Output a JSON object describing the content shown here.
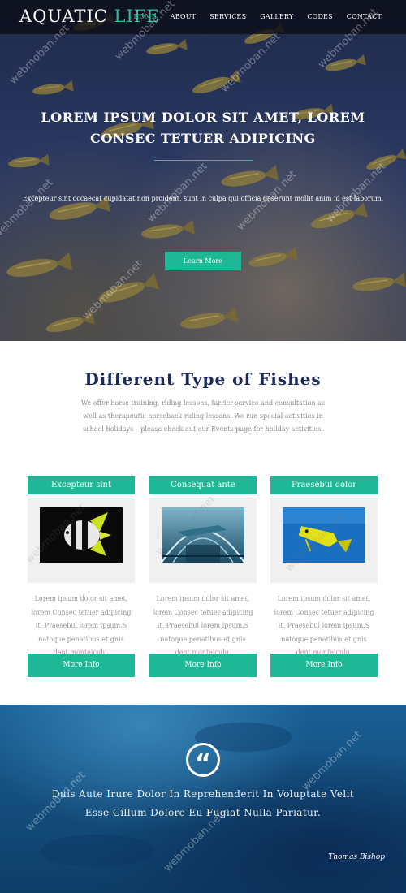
{
  "brand": {
    "part1": "AQUATIC",
    "part2": "LIFE",
    "accent_color": "#2bc0a0"
  },
  "nav": {
    "items": [
      {
        "label": "HOME",
        "active": true
      },
      {
        "label": "ABOUT",
        "active": false
      },
      {
        "label": "SERVICES",
        "active": false
      },
      {
        "label": "GALLERY",
        "active": false
      },
      {
        "label": "CODES",
        "active": false
      },
      {
        "label": "CONTACT",
        "active": false
      }
    ]
  },
  "hero": {
    "title": "LOREM IPSUM DOLOR SIT AMET, LOREM CONSEC TETUER ADIPICING",
    "text": "Excepteur sint occaecat cupidatat non proident, sunt in culpa qui officia deserunt mollit anim id est laborum.",
    "button": "Learn More"
  },
  "fish_section": {
    "title": "Different Type of Fishes",
    "description": "We offer horse training, riding lessons, farrier service and consultation as well as therapeutic horseback riding lessons. We run special activities in school holidays – please check out our Events page for holiday activities.",
    "cards": [
      {
        "title": "Excepteur sint",
        "image": "striped-angelfish-photo",
        "text": "Lorem ipsum dolor sit amet, lorem Consec tetuer adipicing it. Praesebul lorem ipsum.S natoque penatibus et gnis dent monteiculu.",
        "button": "More Info"
      },
      {
        "title": "Consequat ante",
        "image": "aquarium-tunnel-photo",
        "text": "Lorem ipsum dolor sit amet, lorem Consec tetuer adipicing it. Praesebul lorem ipsum.S natoque penatibus et gnis dent monteiculu.",
        "button": "More Info"
      },
      {
        "title": "Praesebul dolor",
        "image": "yellow-boxfish-photo",
        "text": "Lorem ipsum dolor sit amet, lorem Consec tetuer adipicing it. Praesebul lorem ipsum.S natoque penatibus et gnis dent monteiculu.",
        "button": "More Info"
      }
    ]
  },
  "quote": {
    "icon": "quote-icon",
    "text": "Duis Aute Irure Dolor In Reprehenderit In Voluptate Velit Esse Cillum Dolore Eu Fugiat Nulla Pariatur.",
    "author": "Thomas Bishop"
  },
  "watermark": "webmoban.net",
  "colors": {
    "teal": "#1fb896",
    "navy_title": "#1e2a5a"
  }
}
